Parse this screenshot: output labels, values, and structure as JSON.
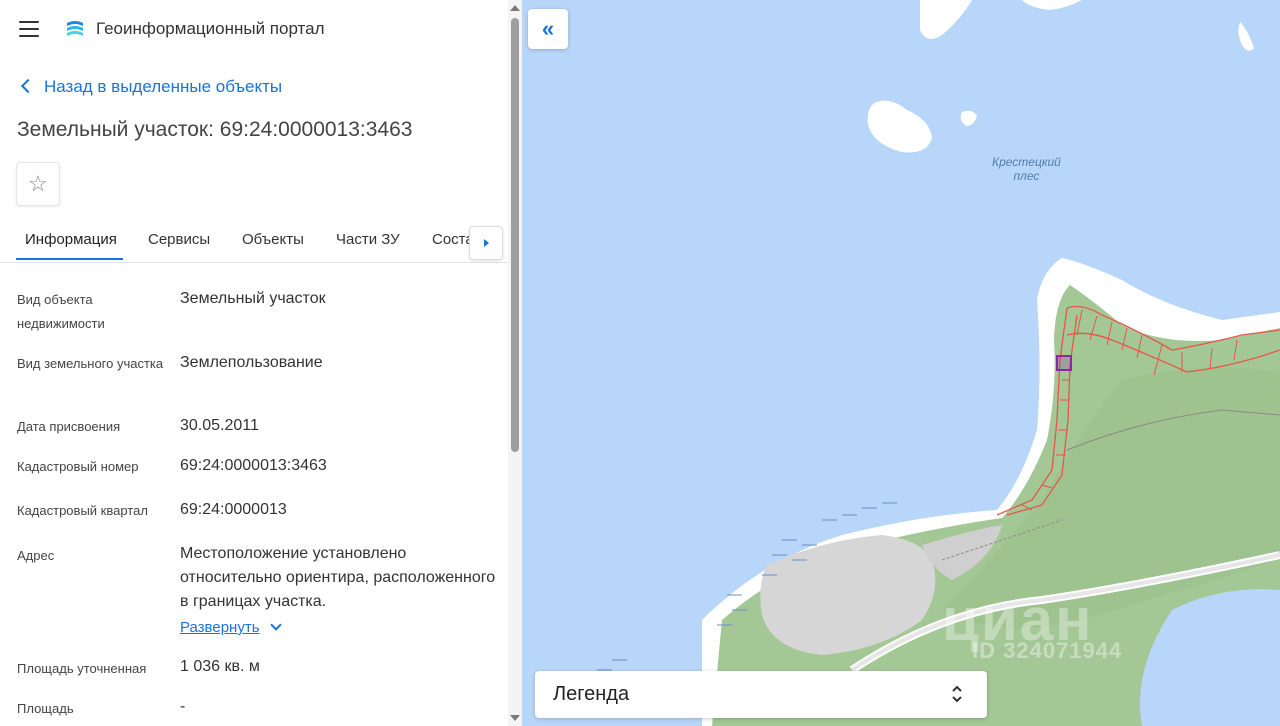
{
  "header": {
    "app_title": "Геоинформационный портал"
  },
  "nav": {
    "back_label": "Назад в выделенные объекты"
  },
  "page": {
    "title": "Земельный участок: 69:24:0000013:3463"
  },
  "tabs": [
    {
      "label": "Информация",
      "active": true
    },
    {
      "label": "Сервисы"
    },
    {
      "label": "Объекты"
    },
    {
      "label": "Части ЗУ"
    },
    {
      "label": "Соста"
    }
  ],
  "fields": [
    {
      "label": "Вид объекта недвижимости",
      "value": "Земельный участок"
    },
    {
      "label": "Вид земельного участка",
      "value": "Землепользование"
    },
    {
      "label": "Дата присвоения",
      "value": "30.05.2011"
    },
    {
      "label": "Кадастровый номер",
      "value": "69:24:0000013:3463"
    },
    {
      "label": "Кадастровый квартал",
      "value": "69:24:0000013"
    },
    {
      "label": "Адрес",
      "value": "Местоположение установлено относительно ориентира, расположенного в границах участка."
    },
    {
      "label": "Площадь уточненная",
      "value": "1 036 кв. м"
    },
    {
      "label": "Площадь",
      "value": "-"
    }
  ],
  "address_expand_label": "Развернуть",
  "map": {
    "place_label_line1": "Крестецкий",
    "place_label_line2": "плес",
    "legend_label": "Легенда",
    "watermark_main": "циан",
    "watermark_id": "ID 324071944"
  },
  "colors": {
    "accent": "#1a73d9",
    "water": "#b8d6f9",
    "land": "#a3c795",
    "parcel_border": "#e8564a",
    "selected_parcel": "#8e24aa"
  }
}
